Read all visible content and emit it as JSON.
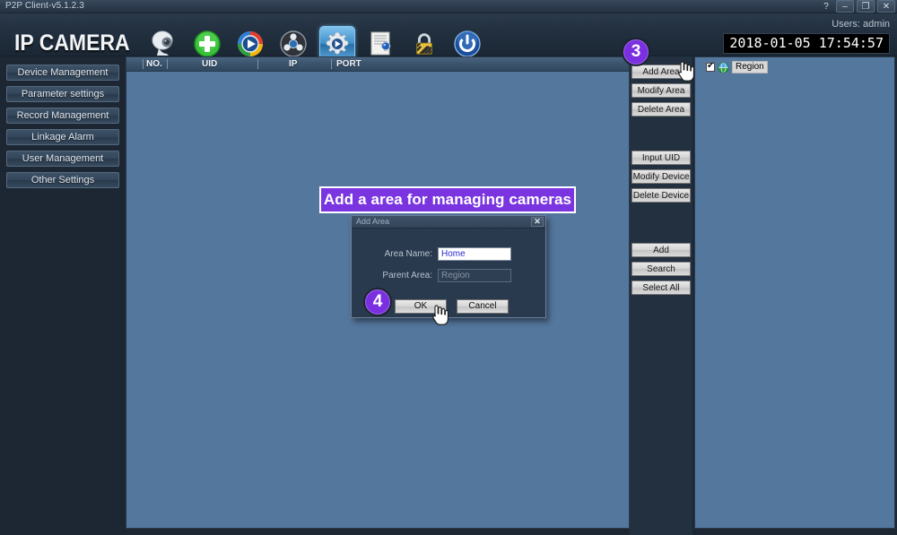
{
  "window": {
    "title": "P2P Client-v5.1.2.3",
    "help_btn": "?",
    "minimize_btn": "–",
    "maximize_btn": "❐",
    "close_btn": "✕"
  },
  "header": {
    "brand": "IP CAMERA",
    "users_text": "Users: admin",
    "datetime": "2018-01-05 17:54:57",
    "toolbar_icons": [
      {
        "name": "camera-icon",
        "selected": false
      },
      {
        "name": "add-icon",
        "selected": false
      },
      {
        "name": "play-icon",
        "selected": false
      },
      {
        "name": "playback-reel-icon",
        "selected": false
      },
      {
        "name": "settings-gear-icon",
        "selected": true
      },
      {
        "name": "log-settings-icon",
        "selected": false
      },
      {
        "name": "lock-icon",
        "selected": false
      },
      {
        "name": "power-icon",
        "selected": false
      }
    ]
  },
  "sidebar": {
    "items": [
      {
        "label": "Device Management"
      },
      {
        "label": "Parameter settings"
      },
      {
        "label": "Record Management"
      },
      {
        "label": "Linkage Alarm"
      },
      {
        "label": "User Management"
      },
      {
        "label": "Other Settings"
      }
    ]
  },
  "device_list": {
    "columns": [
      "NO.",
      "UID",
      "IP",
      "PORT"
    ],
    "rows": []
  },
  "action_buttons": {
    "area_group": [
      "Add Area",
      "Modify Area",
      "Delete Area"
    ],
    "device_group": [
      "Input UID",
      "Modify Device",
      "Delete Device"
    ],
    "bottom_group": [
      "Add",
      "Search",
      "Select All"
    ]
  },
  "tree": {
    "root": {
      "label": "Region",
      "checked": true,
      "icon": "globe-icon",
      "selected": true
    }
  },
  "callout": {
    "banner_text": "Add a area for managing cameras",
    "badge_3": "3",
    "badge_4": "4",
    "accent_color": "#7a35e0"
  },
  "dialog": {
    "title": "Add Area",
    "close_label": "✕",
    "fields": [
      {
        "label": "Area Name:",
        "value": "Home",
        "readonly": false
      },
      {
        "label": "Parent Area:",
        "value": "Region",
        "readonly": true
      }
    ],
    "ok_label": "OK",
    "cancel_label": "Cancel"
  }
}
